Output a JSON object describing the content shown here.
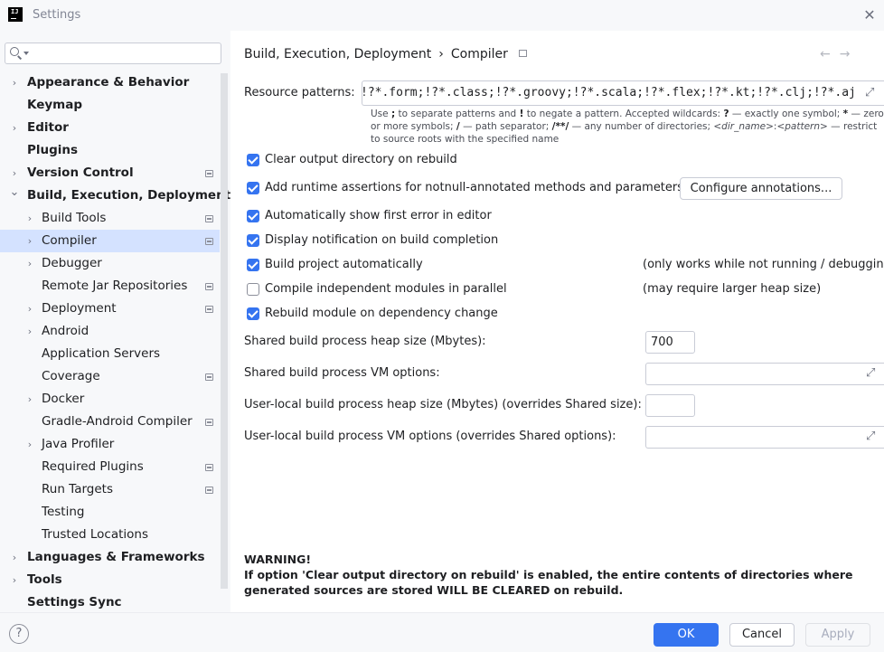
{
  "window": {
    "title": "Settings",
    "logo_text": "IJ"
  },
  "search": {
    "placeholder": ""
  },
  "sidebar": {
    "items": [
      {
        "label": "Appearance & Behavior",
        "expand": "right",
        "bold": true,
        "level": 0,
        "project": false
      },
      {
        "label": "Keymap",
        "expand": "",
        "bold": true,
        "level": 0,
        "project": false
      },
      {
        "label": "Editor",
        "expand": "right",
        "bold": true,
        "level": 0,
        "project": false
      },
      {
        "label": "Plugins",
        "expand": "",
        "bold": true,
        "level": 0,
        "project": false
      },
      {
        "label": "Version Control",
        "expand": "right",
        "bold": true,
        "level": 0,
        "project": true
      },
      {
        "label": "Build, Execution, Deployment",
        "expand": "down",
        "bold": true,
        "level": 0,
        "project": false
      },
      {
        "label": "Build Tools",
        "expand": "right",
        "bold": false,
        "level": 1,
        "project": true
      },
      {
        "label": "Compiler",
        "expand": "right",
        "bold": false,
        "level": 1,
        "project": true,
        "selected": true
      },
      {
        "label": "Debugger",
        "expand": "right",
        "bold": false,
        "level": 1,
        "project": false
      },
      {
        "label": "Remote Jar Repositories",
        "expand": "",
        "bold": false,
        "level": 1,
        "project": true
      },
      {
        "label": "Deployment",
        "expand": "right",
        "bold": false,
        "level": 1,
        "project": true
      },
      {
        "label": "Android",
        "expand": "right",
        "bold": false,
        "level": 1,
        "project": false
      },
      {
        "label": "Application Servers",
        "expand": "",
        "bold": false,
        "level": 1,
        "project": false
      },
      {
        "label": "Coverage",
        "expand": "",
        "bold": false,
        "level": 1,
        "project": true
      },
      {
        "label": "Docker",
        "expand": "right",
        "bold": false,
        "level": 1,
        "project": false
      },
      {
        "label": "Gradle-Android Compiler",
        "expand": "",
        "bold": false,
        "level": 1,
        "project": true
      },
      {
        "label": "Java Profiler",
        "expand": "right",
        "bold": false,
        "level": 1,
        "project": false
      },
      {
        "label": "Required Plugins",
        "expand": "",
        "bold": false,
        "level": 1,
        "project": true
      },
      {
        "label": "Run Targets",
        "expand": "",
        "bold": false,
        "level": 1,
        "project": true
      },
      {
        "label": "Testing",
        "expand": "",
        "bold": false,
        "level": 1,
        "project": false
      },
      {
        "label": "Trusted Locations",
        "expand": "",
        "bold": false,
        "level": 1,
        "project": false
      },
      {
        "label": "Languages & Frameworks",
        "expand": "right",
        "bold": true,
        "level": 0,
        "project": false
      },
      {
        "label": "Tools",
        "expand": "right",
        "bold": true,
        "level": 0,
        "project": false
      },
      {
        "label": "Settings Sync",
        "expand": "",
        "bold": true,
        "level": 0,
        "project": false
      }
    ]
  },
  "breadcrumb": {
    "parent": "Build, Execution, Deployment",
    "sep": "›",
    "current": "Compiler"
  },
  "nav": {
    "back": "←",
    "forward": "→"
  },
  "resource": {
    "label": "Resource patterns:",
    "value": "!?*.form;!?*.class;!?*.groovy;!?*.scala;!?*.flex;!?*.kt;!?*.clj;!?*.aj",
    "hint_parts": {
      "p1": "Use ",
      "b1": ";",
      "p2": " to separate patterns and ",
      "b2": "!",
      "p3": " to negate a pattern. Accepted wildcards: ",
      "b3": "?",
      "p4": " — exactly one symbol; ",
      "b4": "*",
      "p5": " — zero or more symbols; ",
      "b5": "/",
      "p6": " — path separator; ",
      "b6": "/**/",
      "p7": " — any number of directories; ",
      "i1": "<dir_name>",
      "p8": ":",
      "i2": "<pattern>",
      "p9": " — restrict to source roots with the specified name"
    }
  },
  "options": [
    {
      "label": "Clear output directory on rebuild",
      "checked": true
    },
    {
      "label": "Add runtime assertions for notnull-annotated methods and parameters",
      "checked": true
    },
    {
      "label": "Automatically show first error in editor",
      "checked": true
    },
    {
      "label": "Display notification on build completion",
      "checked": true
    },
    {
      "label": "Build project automatically",
      "checked": true
    },
    {
      "label": "Compile independent modules in parallel",
      "checked": false
    },
    {
      "label": "Rebuild module on dependency change",
      "checked": true
    }
  ],
  "configure_button": "Configure annotations...",
  "notes": {
    "build_auto": "(only works while not running / debugging)",
    "parallel": "(may require larger heap size)"
  },
  "fields": {
    "heap_label": "Shared build process heap size (Mbytes):",
    "heap_value": "700",
    "vm_label": "Shared build process VM options:",
    "vm_value": "",
    "local_heap_label": "User-local build process heap size (Mbytes) (overrides Shared size):",
    "local_heap_value": "",
    "local_vm_label": "User-local build process VM options (overrides Shared options):",
    "local_vm_value": ""
  },
  "warning": {
    "title": "WARNING!",
    "text": "If option 'Clear output directory on rebuild' is enabled, the entire contents of directories where generated sources are stored WILL BE CLEARED on rebuild."
  },
  "footer": {
    "help": "?",
    "ok": "OK",
    "cancel": "Cancel",
    "apply": "Apply"
  },
  "colors": {
    "accent": "#3574f0",
    "selection": "#d4e2ff",
    "sidebar_bg": "#f7f8fa"
  }
}
